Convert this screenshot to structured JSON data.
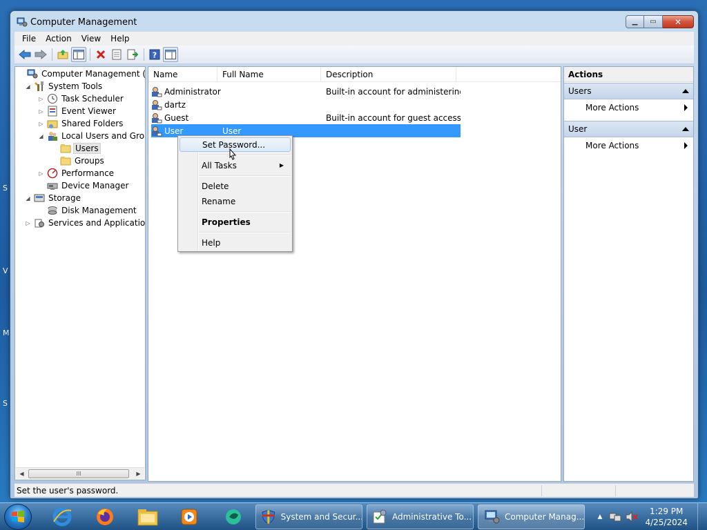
{
  "window": {
    "title": "Computer Management"
  },
  "menubar": [
    "File",
    "Action",
    "View",
    "Help"
  ],
  "tree": [
    {
      "label": "Computer Management (Local",
      "level": 0,
      "arrow": "",
      "icon": "computer-management-icon"
    },
    {
      "label": "System Tools",
      "level": 1,
      "arrow": "◢",
      "icon": "system-tools-icon"
    },
    {
      "label": "Task Scheduler",
      "level": 2,
      "arrow": "▷",
      "icon": "clock-icon"
    },
    {
      "label": "Event Viewer",
      "level": 2,
      "arrow": "▷",
      "icon": "event-viewer-icon"
    },
    {
      "label": "Shared Folders",
      "level": 2,
      "arrow": "▷",
      "icon": "shared-folder-icon"
    },
    {
      "label": "Local Users and Groups",
      "level": 2,
      "arrow": "◢",
      "icon": "users-groups-icon"
    },
    {
      "label": "Users",
      "level": 3,
      "arrow": "",
      "icon": "folder-icon",
      "selected": true
    },
    {
      "label": "Groups",
      "level": 3,
      "arrow": "",
      "icon": "folder-icon"
    },
    {
      "label": "Performance",
      "level": 2,
      "arrow": "▷",
      "icon": "performance-icon"
    },
    {
      "label": "Device Manager",
      "level": 2,
      "arrow": "",
      "icon": "device-manager-icon"
    },
    {
      "label": "Storage",
      "level": 1,
      "arrow": "◢",
      "icon": "storage-icon"
    },
    {
      "label": "Disk Management",
      "level": 2,
      "arrow": "",
      "icon": "disk-management-icon"
    },
    {
      "label": "Services and Applications",
      "level": 1,
      "arrow": "▷",
      "icon": "services-icon"
    }
  ],
  "list": {
    "columns": [
      "Name",
      "Full Name",
      "Description"
    ],
    "rows": [
      {
        "name": "Administrator",
        "full_name": "",
        "description": "Built-in account for administering..."
      },
      {
        "name": "dartz",
        "full_name": "",
        "description": ""
      },
      {
        "name": "Guest",
        "full_name": "",
        "description": "Built-in account for guest access t..."
      },
      {
        "name": "User",
        "full_name": "User",
        "description": "",
        "selected": true
      }
    ]
  },
  "actions": {
    "title": "Actions",
    "sections": [
      {
        "label": "Users",
        "items": [
          "More Actions"
        ]
      },
      {
        "label": "User",
        "items": [
          "More Actions"
        ]
      }
    ]
  },
  "context_menu": {
    "items": [
      {
        "label": "Set Password...",
        "hover": true
      },
      {
        "separator": true
      },
      {
        "label": "All Tasks",
        "submenu": true
      },
      {
        "separator": true
      },
      {
        "label": "Delete"
      },
      {
        "label": "Rename"
      },
      {
        "separator": true
      },
      {
        "label": "Properties",
        "bold": true
      },
      {
        "separator": true
      },
      {
        "label": "Help"
      }
    ]
  },
  "statusbar": {
    "text": "Set the user's password."
  },
  "taskbar": {
    "pinned": [
      "internet-explorer-icon",
      "firefox-icon",
      "file-explorer-icon",
      "media-player-icon",
      "app-icon"
    ],
    "buttons": [
      {
        "label": "System and Secur...",
        "icon": "shield-icon"
      },
      {
        "label": "Administrative To...",
        "icon": "admin-tools-icon"
      },
      {
        "label": "Computer Manag...",
        "icon": "computer-management-icon",
        "active": true
      }
    ],
    "clock": {
      "time": "1:29 PM",
      "date": "4/25/2024"
    }
  }
}
